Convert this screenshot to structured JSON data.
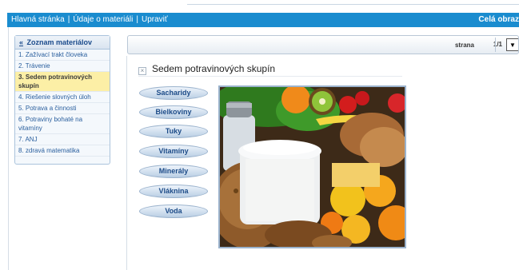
{
  "topbar": {
    "nav": [
      "Hlavná stránka",
      "Údaje o materiáli",
      "Upraviť"
    ],
    "separator": "|",
    "fullscreen": "Celá obraz"
  },
  "sidebar": {
    "header": "Zoznam materiálov",
    "arrow": "«",
    "items": [
      {
        "label": "1. Zažívací trakt človeka"
      },
      {
        "label": "2. Trávenie"
      },
      {
        "label": "3. Sedem potravinových skupín"
      },
      {
        "label": "4. Riešenie slovných úloh"
      },
      {
        "label": "5. Potrava a činnosti"
      },
      {
        "label": "6. Potraviny bohaté na vitamíny"
      },
      {
        "label": "7. ANJ"
      },
      {
        "label": "8. zdravá matematika"
      }
    ],
    "active_index": 2
  },
  "pager": {
    "label": "strana",
    "value": "1/1",
    "dropdown": "▼"
  },
  "content": {
    "close": "×",
    "title": "Sedem potravinových skupín",
    "groups": [
      "Sacharidy",
      "Bielkoviny",
      "Tuky",
      "Vitamíny",
      "Minerály",
      "Vláknina",
      "Voda"
    ]
  },
  "colors": {
    "topbar": "#1a8ccf",
    "sidebar_active": "#fcefa6",
    "link": "#2a5f9e"
  },
  "icons": [
    "close-icon",
    "chevron-down-icon"
  ]
}
